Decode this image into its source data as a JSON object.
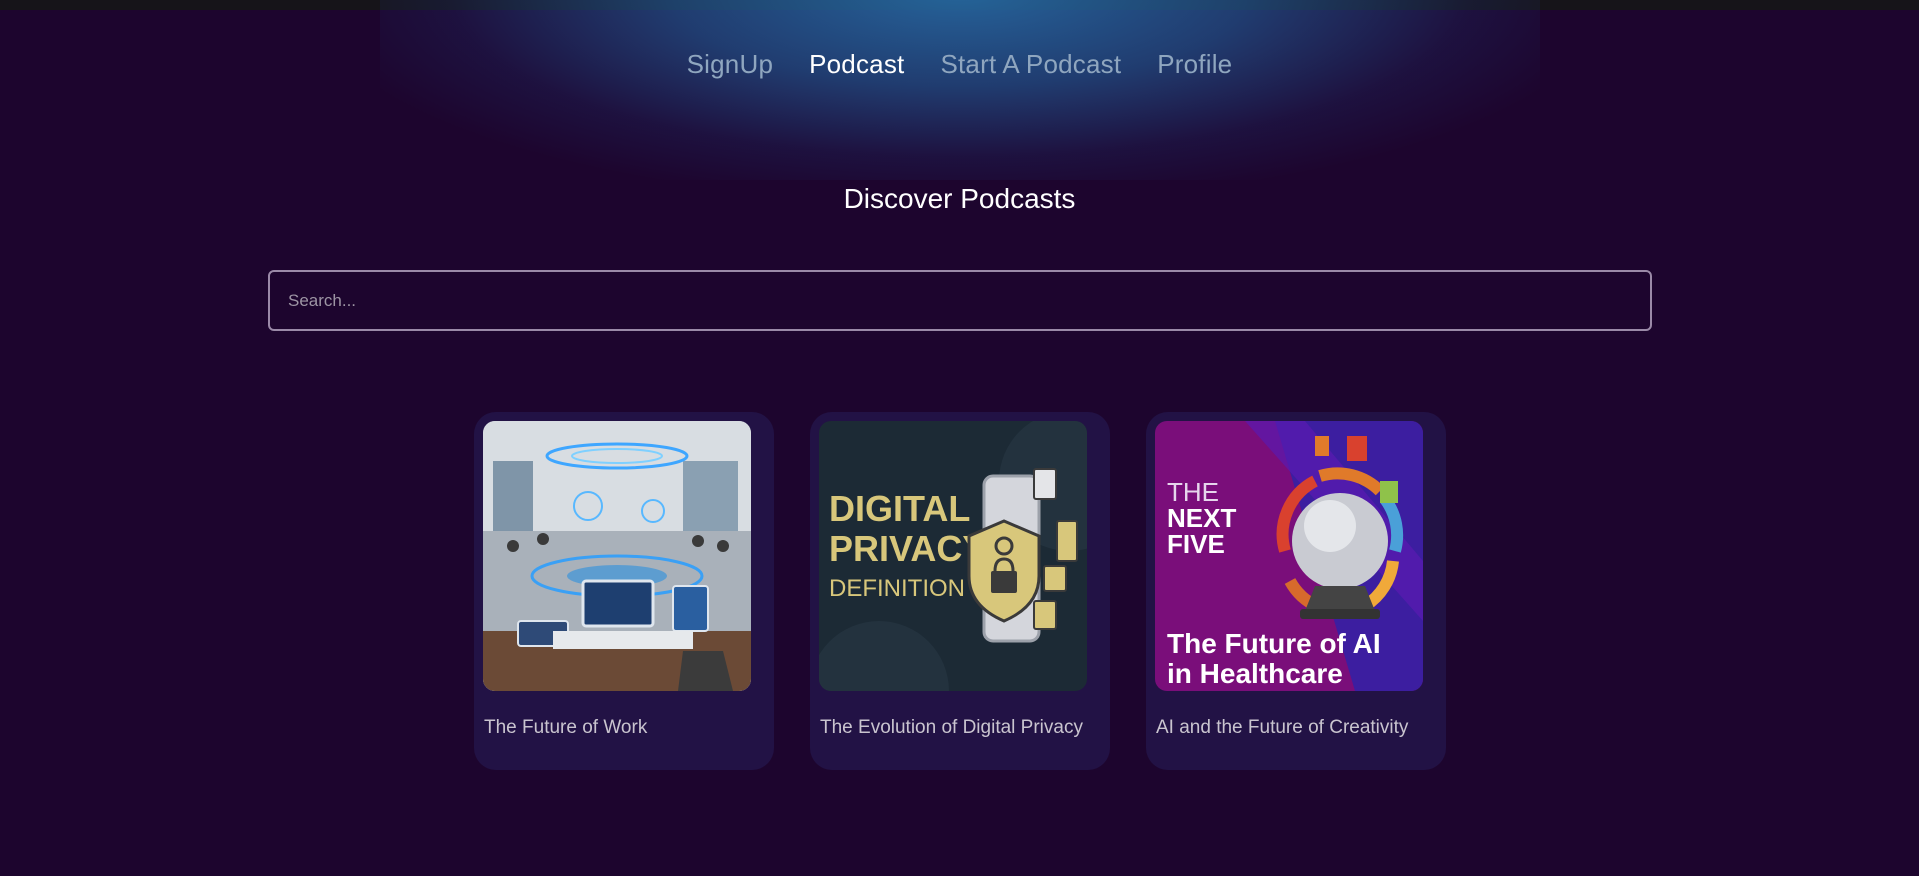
{
  "nav": {
    "items": [
      {
        "label": "SignUp",
        "active": false
      },
      {
        "label": "Podcast",
        "active": true
      },
      {
        "label": "Start A Podcast",
        "active": false
      },
      {
        "label": "Profile",
        "active": false
      }
    ]
  },
  "main": {
    "title": "Discover Podcasts",
    "search": {
      "placeholder": "Search...",
      "value": ""
    }
  },
  "podcasts": [
    {
      "title": "The Future of Work",
      "image": "office-hologram-illustration"
    },
    {
      "title": "The Evolution of Digital Privacy",
      "image": "digital-privacy-illustration",
      "image_text": [
        "DIGITAL",
        "PRIVACY",
        "DEFINITION"
      ]
    },
    {
      "title": "AI and the Future of Creativity",
      "image": "crystal-ball-illustration",
      "image_text": [
        "THE",
        "NEXT",
        "FIVE",
        "The Future of AI",
        "in Healthcare"
      ]
    }
  ],
  "colors": {
    "background": "#1d052e",
    "card": "#221245",
    "nav_inactive": "#8fa6bf",
    "nav_active": "#ffffff",
    "glow": "#2668a0"
  }
}
